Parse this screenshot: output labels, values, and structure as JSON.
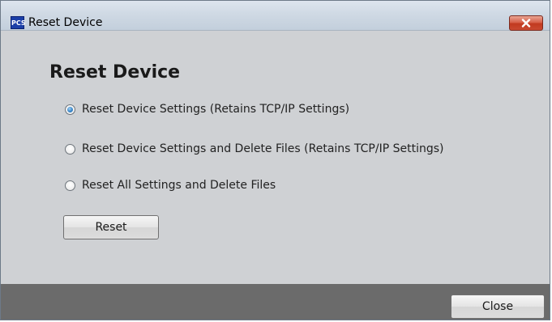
{
  "window": {
    "title": "Reset Device",
    "app_icon_text": "PCS"
  },
  "content": {
    "heading": "Reset Device",
    "options": [
      {
        "label": "Reset Device Settings (Retains TCP/IP Settings)",
        "selected": true
      },
      {
        "label": "Reset Device Settings and Delete Files (Retains TCP/IP Settings)",
        "selected": false
      },
      {
        "label": "Reset All Settings and Delete Files",
        "selected": false
      }
    ],
    "reset_label": "Reset"
  },
  "footer": {
    "close_label": "Close"
  },
  "colors": {
    "dialog_background": "#cfd1d4",
    "footer_background": "#6b6b6b",
    "close_button_red": "#c94a31",
    "radio_selected_blue": "#3b86c8"
  },
  "icons": {
    "app": "pcs-app-icon",
    "close": "close-x-icon"
  }
}
